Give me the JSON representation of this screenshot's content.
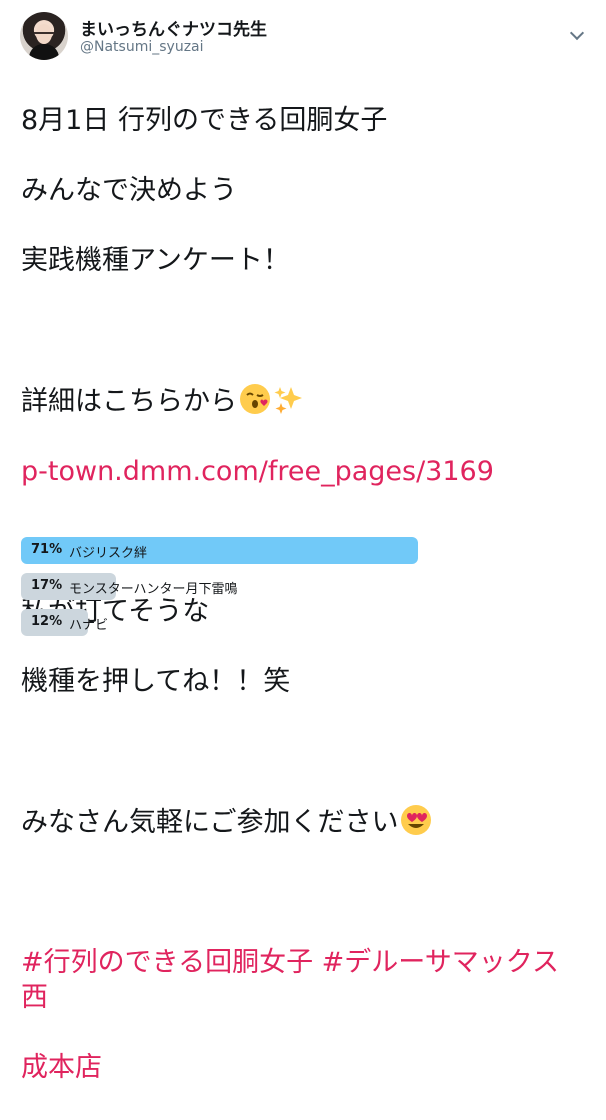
{
  "author": {
    "display_name": "まいっちんぐナツコ先生",
    "screen_name": "@Natsumi_syuzai"
  },
  "tweet": {
    "line1": "8月1日 行列のできる回胴女子",
    "line2": "みんなで決めよう",
    "line3": "実践機種アンケート！",
    "line4": "詳細はこちらから",
    "link": "p-town.dmm.com/free_pages/3169",
    "line5": "私が打てそうな",
    "line6": "機種を押してね！！笑",
    "line7": "みなさん気軽にご参加ください",
    "hashtags_line1": "#行列のできる回胴女子 #デルーサマックス西",
    "hashtags_line2": "成本店"
  },
  "icons": {
    "menu": "chevron-down-icon",
    "emoji1": "kissing-face-emoji",
    "emoji2": "sparkles-emoji",
    "emoji3": "heart-eyes-emoji"
  },
  "poll": {
    "options": [
      {
        "pct": "71%",
        "label": "バジリスク絆",
        "value": 71,
        "color": "#71c9f8"
      },
      {
        "pct": "17%",
        "label": "モンスターハンター月下雷鳴",
        "value": 17,
        "color": "#ccd6dd"
      },
      {
        "pct": "12%",
        "label": "ハナビ",
        "value": 12,
        "color": "#ccd6dd"
      }
    ]
  }
}
